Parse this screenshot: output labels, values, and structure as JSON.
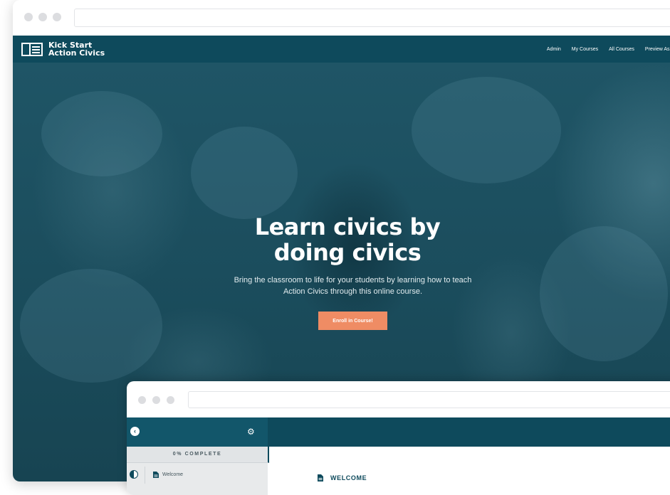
{
  "brand": {
    "line1": "Kick Start",
    "line2": "Action Civics",
    "logo_icon": "book-icon"
  },
  "nav": {
    "items": [
      "Admin",
      "My Courses",
      "All Courses",
      "Preview As ▾"
    ]
  },
  "hero": {
    "title_line1": "Learn civics by",
    "title_line2": "doing civics",
    "subtitle": "Bring the classroom to life for your students by learning how to teach Action Civics through this online course.",
    "button": "Enroll in Course!"
  },
  "course_player": {
    "back_icon": "chevron-left-icon",
    "settings_icon": "gear-icon",
    "progress": "0% COMPLETE",
    "progress_fraction": 0,
    "lesson": "Welcome",
    "section_heading": "WELCOME"
  },
  "colors": {
    "primary": "#0e4a5c",
    "accent": "#ef8c64",
    "hero_bg": "#1d5061"
  }
}
